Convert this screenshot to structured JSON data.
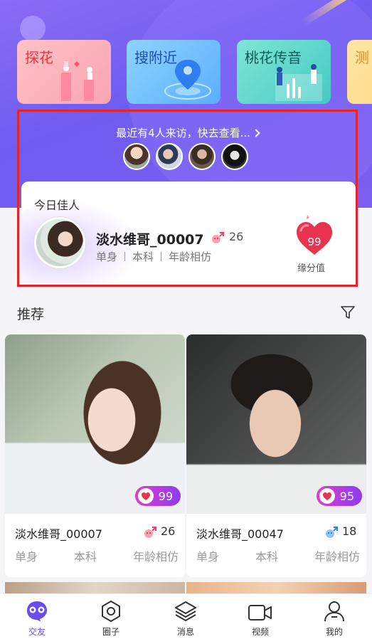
{
  "features": [
    {
      "label": "探花",
      "icon": "tanhua-illustration"
    },
    {
      "label": "搜附近",
      "icon": "location-pin-illustration"
    },
    {
      "label": "桃花传音",
      "icon": "peach-voice-illustration"
    },
    {
      "label": "测",
      "icon": "test-illustration"
    }
  ],
  "visitors": {
    "text": "最近有4人来访，快去查看...",
    "avatars": [
      "visitor-avatar-1",
      "visitor-avatar-2",
      "visitor-avatar-3",
      "visitor-avatar-4"
    ]
  },
  "today": {
    "title": "今日佳人",
    "name": "淡水维哥_00007",
    "gender": "female",
    "age": "26",
    "tags": [
      "单身",
      "本科",
      "年龄相仿"
    ],
    "score": "99",
    "score_label": "缘分值"
  },
  "recommend": {
    "title": "推荐",
    "cards": [
      {
        "name": "淡水维哥_00007",
        "gender": "female",
        "age": "26",
        "score": "99",
        "tags": [
          "单身",
          "本科",
          "年龄相仿"
        ]
      },
      {
        "name": "淡水维哥_00047",
        "gender": "male",
        "age": "18",
        "score": "95",
        "tags": [
          "单身",
          "本科",
          "年龄相仿"
        ]
      }
    ]
  },
  "tabbar": [
    {
      "label": "交友",
      "icon": "friend-icon",
      "active": true
    },
    {
      "label": "圈子",
      "icon": "circle-icon",
      "active": false
    },
    {
      "label": "消息",
      "icon": "message-icon",
      "active": false
    },
    {
      "label": "视频",
      "icon": "video-icon",
      "active": false
    },
    {
      "label": "我的",
      "icon": "profile-icon",
      "active": false
    }
  ],
  "colors": {
    "brand": "#6e5cf0",
    "accent_pink": "#e03bd0",
    "highlight_border": "#e4242b"
  }
}
